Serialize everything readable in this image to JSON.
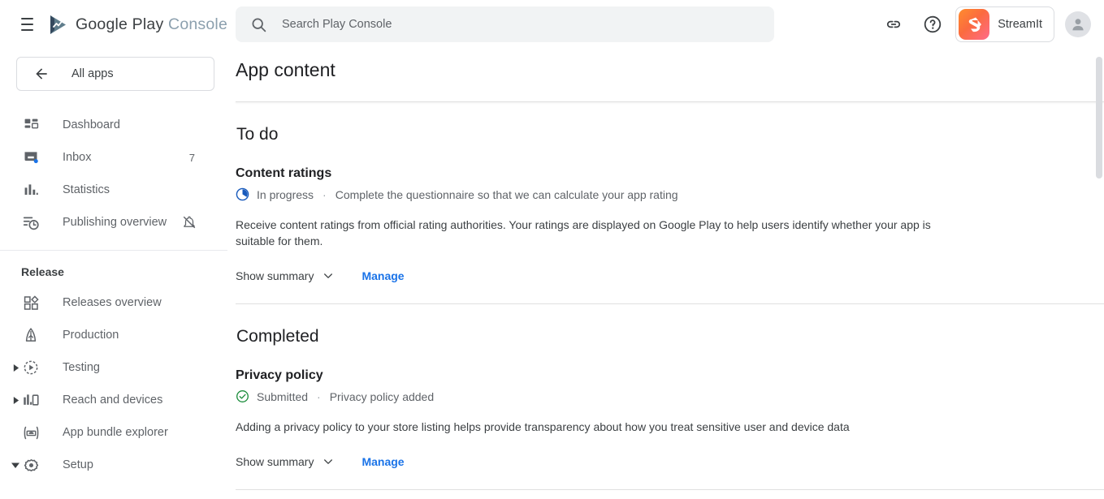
{
  "brand": {
    "google": "Google Play",
    "console": "Console",
    "logo_icon": "play-triangle-chart-icon",
    "menu_icon": "hamburger-menu-icon"
  },
  "sidebar": {
    "all_apps": {
      "label": "All apps",
      "icon": "arrow-back-icon"
    },
    "items": [
      {
        "label": "Dashboard",
        "icon": "dashboard-grid-icon"
      },
      {
        "label": "Inbox",
        "icon": "inbox-tray-icon",
        "badge": "7"
      },
      {
        "label": "Statistics",
        "icon": "bar-chart-icon"
      },
      {
        "label": "Publishing overview",
        "icon": "publishing-clock-icon",
        "trailing_icon": "notifications-off-icon"
      }
    ],
    "release_section": {
      "label": "Release",
      "items": [
        {
          "label": "Releases overview",
          "icon": "releases-overview-icon",
          "expandable": false
        },
        {
          "label": "Production",
          "icon": "production-rocket-icon",
          "expandable": false
        },
        {
          "label": "Testing",
          "icon": "testing-play-circle-icon",
          "expandable": true,
          "expanded": false
        },
        {
          "label": "Reach and devices",
          "icon": "reach-devices-icon",
          "expandable": true,
          "expanded": false
        },
        {
          "label": "App bundle explorer",
          "icon": "app-bundle-android-icon",
          "expandable": false
        },
        {
          "label": "Setup",
          "icon": "setup-gear-icon",
          "expandable": true,
          "expanded": true
        }
      ]
    }
  },
  "topbar": {
    "search": {
      "placeholder": "Search Play Console",
      "value": "",
      "icon": "search-icon"
    },
    "link_icon": "link-chain-icon",
    "help_icon": "help-question-icon",
    "app_chip": {
      "name": "StreamIt",
      "icon": "streamit-app-icon"
    },
    "avatar_icon": "user-avatar-icon"
  },
  "main": {
    "page_title": "App content",
    "sections": [
      {
        "heading": "To do",
        "items": [
          {
            "title": "Content ratings",
            "status": "In progress",
            "status_icon": "in-progress-clock-icon",
            "status_color": "#185abc",
            "status_detail": "Complete the questionnaire so that we can calculate your app rating",
            "description": "Receive content ratings from official rating authorities. Your ratings are displayed on Google Play to help users identify whether your app is suitable for them.",
            "show_summary_label": "Show summary",
            "manage_label": "Manage"
          }
        ]
      },
      {
        "heading": "Completed",
        "items": [
          {
            "title": "Privacy policy",
            "status": "Submitted",
            "status_icon": "check-circle-icon",
            "status_color": "#1e8e3e",
            "status_detail": "Privacy policy added",
            "description": "Adding a privacy policy to your store listing helps provide transparency about how you treat sensitive user and device data",
            "show_summary_label": "Show summary",
            "manage_label": "Manage"
          }
        ]
      }
    ],
    "separator_dot": "·",
    "chevron_icon": "chevron-down-icon"
  },
  "colors": {
    "link_blue": "#1a73e8",
    "in_progress_blue": "#185abc",
    "completed_green": "#1e8e3e",
    "text_primary": "#202124",
    "text_secondary": "#5f6368"
  }
}
